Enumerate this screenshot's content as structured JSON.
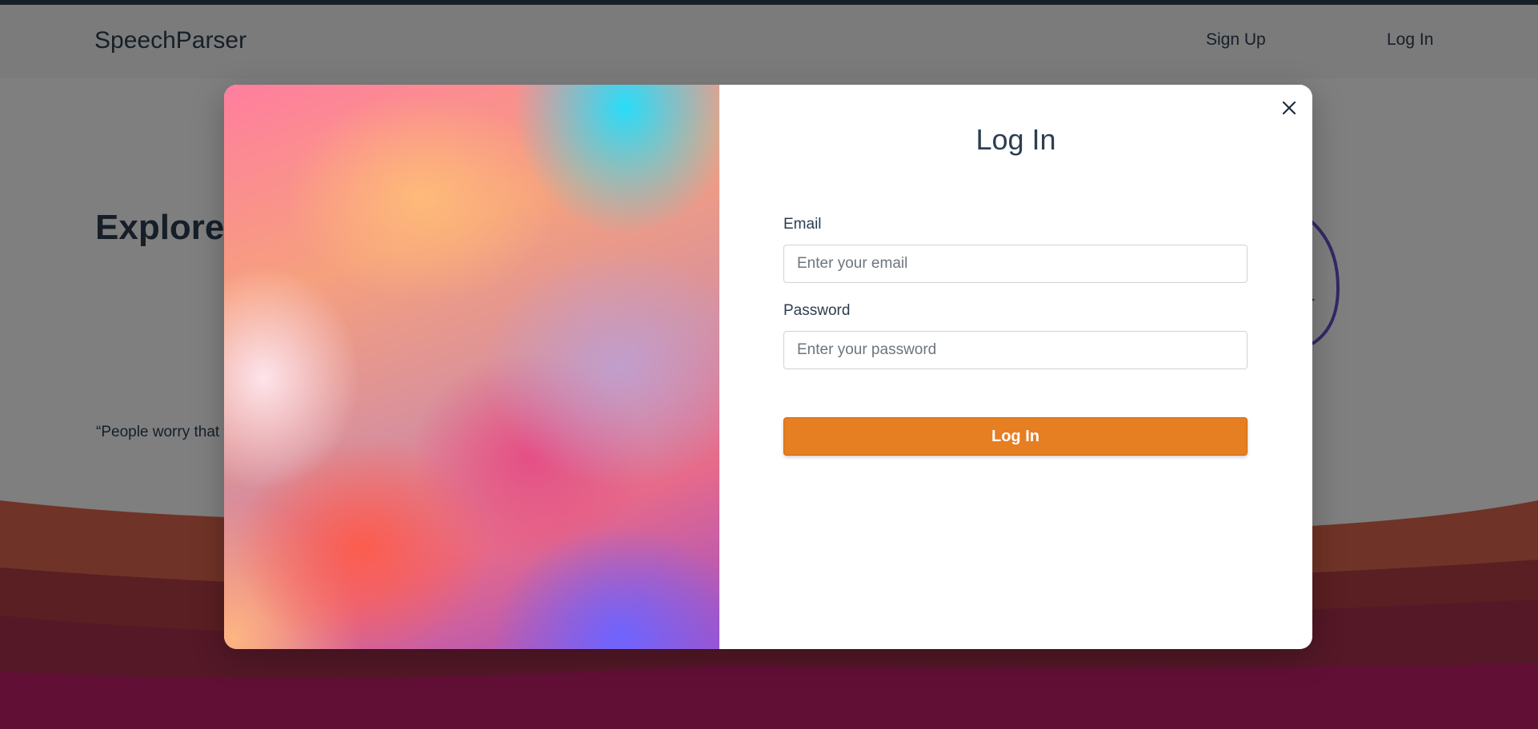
{
  "navbar": {
    "brand": "SpeechParser",
    "links": [
      {
        "label": "Sign Up"
      },
      {
        "label": "Log In"
      }
    ]
  },
  "hero": {
    "title": "Explore th video tran",
    "quote": "“People worry that that they're too stu"
  },
  "modal": {
    "title": "Log In",
    "close_icon": "close-icon",
    "email": {
      "label": "Email",
      "placeholder": "Enter your email",
      "value": ""
    },
    "password": {
      "label": "Password",
      "placeholder": "Enter your password",
      "value": ""
    },
    "submit_label": "Log In"
  },
  "colors": {
    "text": "#2c3e50",
    "accent": "#e67e22",
    "wave_top": "#e0664f",
    "wave_mid": "#a8344a",
    "wave_bottom": "#c51e6c"
  }
}
